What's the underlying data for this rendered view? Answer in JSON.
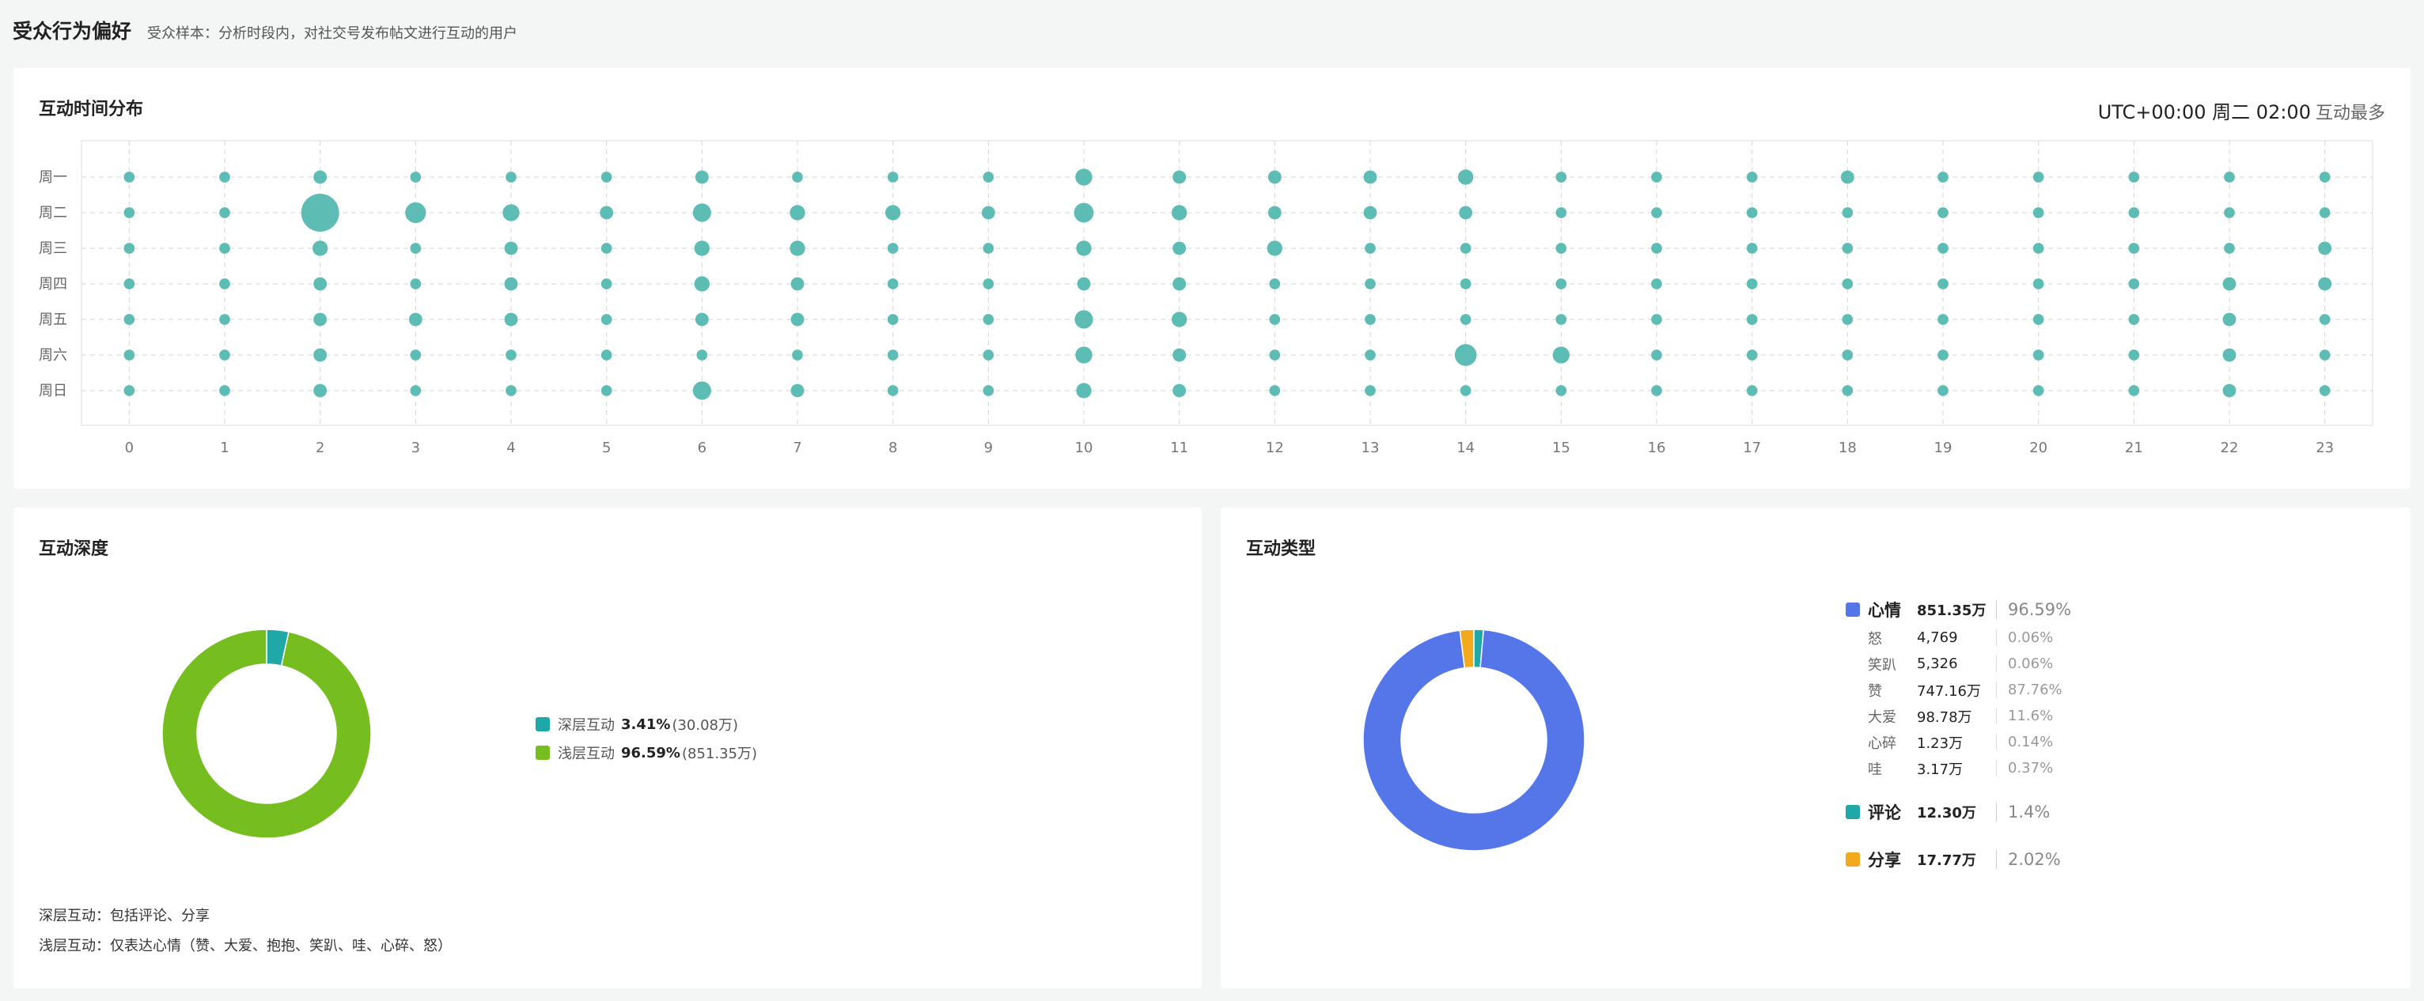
{
  "header": {
    "title": "受众行为偏好",
    "subtitle": "受众样本：分析时段内，对社交号发布帖文进行互动的用户"
  },
  "time_card": {
    "title": "互动时间分布",
    "peak_label": "UTC+00:00 周二 02:00",
    "peak_suffix": "互动最多"
  },
  "depth_card": {
    "title": "互动深度",
    "legend": [
      {
        "name": "深层互动",
        "pct": "3.41%",
        "amount": "(30.08万)"
      },
      {
        "name": "浅层互动",
        "pct": "96.59%",
        "amount": "(851.35万)"
      }
    ],
    "notes": [
      "深层互动：包括评论、分享",
      "浅层互动：仅表达心情（赞、大爱、抱抱、笑趴、哇、心碎、怒）"
    ]
  },
  "type_card": {
    "title": "互动类型",
    "mood": {
      "name": "心情",
      "value": "851.35万",
      "pct": "96.59%"
    },
    "mood_items": [
      {
        "name": "怒",
        "value": "4,769",
        "pct": "0.06%"
      },
      {
        "name": "笑趴",
        "value": "5,326",
        "pct": "0.06%"
      },
      {
        "name": "赞",
        "value": "747.16万",
        "pct": "87.76%"
      },
      {
        "name": "大爱",
        "value": "98.78万",
        "pct": "11.6%"
      },
      {
        "name": "心碎",
        "value": "1.23万",
        "pct": "0.14%"
      },
      {
        "name": "哇",
        "value": "3.17万",
        "pct": "0.37%"
      }
    ],
    "comment": {
      "name": "评论",
      "value": "12.30万",
      "pct": "1.4%"
    },
    "share": {
      "name": "分享",
      "value": "17.77万",
      "pct": "2.02%"
    }
  },
  "colors": {
    "bubble": "#5dbcb3",
    "deep": "#20a8a8",
    "shallow": "#76be1f",
    "mood": "#5576e8",
    "comment": "#20a8a8",
    "share": "#f2a91d"
  },
  "chart_data": [
    {
      "type": "scatter",
      "subtype": "bubble",
      "title": "互动时间分布",
      "x": [
        0,
        1,
        2,
        3,
        4,
        5,
        6,
        7,
        8,
        9,
        10,
        11,
        12,
        13,
        14,
        15,
        16,
        17,
        18,
        19,
        20,
        21,
        22,
        23
      ],
      "y_categories": [
        "周一",
        "周二",
        "周三",
        "周四",
        "周五",
        "周六",
        "周日"
      ],
      "grid": true,
      "values": [
        [
          1,
          1,
          2,
          1,
          1,
          1,
          2,
          1,
          1,
          1,
          4,
          2,
          2,
          2,
          3,
          1,
          1,
          1,
          2,
          1,
          1,
          1,
          1,
          1
        ],
        [
          1,
          1,
          30,
          7,
          4,
          2,
          5,
          3,
          3,
          2,
          6,
          3,
          2,
          2,
          2,
          1,
          1,
          1,
          1,
          1,
          1,
          1,
          1,
          1
        ],
        [
          1,
          1,
          3,
          1,
          2,
          1,
          3,
          3,
          1,
          1,
          3,
          2,
          3,
          1,
          1,
          1,
          1,
          1,
          1,
          1,
          1,
          1,
          1,
          2
        ],
        [
          1,
          1,
          2,
          1,
          2,
          1,
          3,
          2,
          1,
          1,
          2,
          2,
          1,
          1,
          1,
          1,
          1,
          1,
          1,
          1,
          1,
          1,
          2,
          2
        ],
        [
          1,
          1,
          2,
          2,
          2,
          1,
          2,
          2,
          1,
          1,
          5,
          3,
          1,
          1,
          1,
          1,
          1,
          1,
          1,
          1,
          1,
          1,
          2,
          1
        ],
        [
          1,
          1,
          2,
          1,
          1,
          1,
          1,
          1,
          1,
          1,
          4,
          2,
          1,
          1,
          8,
          4,
          1,
          1,
          1,
          1,
          1,
          1,
          2,
          1
        ],
        [
          1,
          1,
          2,
          1,
          1,
          1,
          5,
          2,
          1,
          1,
          3,
          2,
          1,
          1,
          1,
          1,
          1,
          1,
          1,
          1,
          1,
          1,
          2,
          1
        ]
      ]
    },
    {
      "type": "pie",
      "title": "互动深度",
      "donut": true,
      "labels": [
        "深层互动",
        "浅层互动"
      ],
      "values": [
        3.41,
        96.59
      ]
    },
    {
      "type": "pie",
      "title": "互动类型",
      "donut": true,
      "labels": [
        "心情",
        "评论",
        "分享"
      ],
      "values": [
        96.59,
        1.4,
        2.02
      ]
    }
  ]
}
